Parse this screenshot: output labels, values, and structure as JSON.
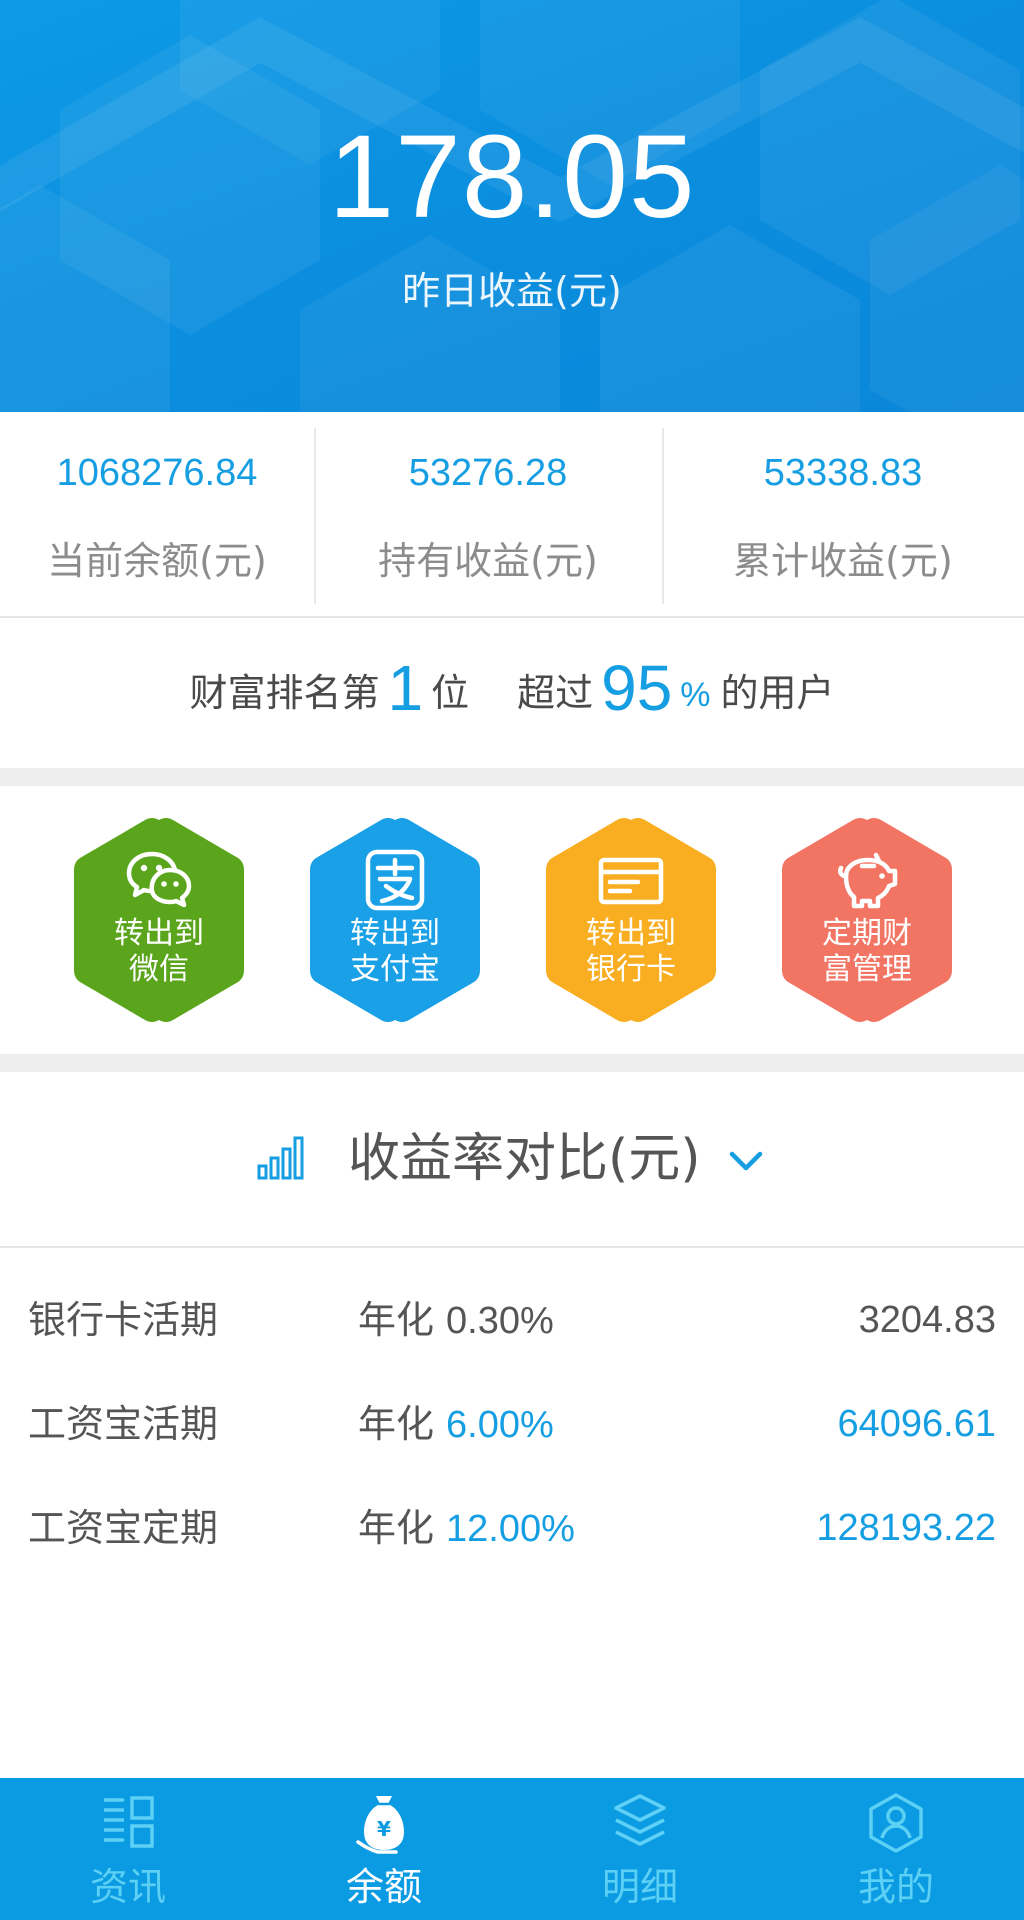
{
  "header": {
    "yesterday_income": "178.05",
    "yesterday_income_label": "昨日收益(元)"
  },
  "stats": [
    {
      "value": "1068276.84",
      "label": "当前余额(元)"
    },
    {
      "value": "53276.28",
      "label": "持有收益(元)"
    },
    {
      "value": "53338.83",
      "label": "累计收益(元)"
    }
  ],
  "ranking": {
    "prefix": "财富排名第",
    "rank": "1",
    "rank_suffix": "位",
    "beat_prefix": "超过",
    "percent": "95",
    "percent_sign": "%",
    "beat_suffix": "的用户"
  },
  "actions": [
    {
      "line1": "转出到",
      "line2": "微信",
      "icon": "wechat-icon",
      "color": "#5aa51c"
    },
    {
      "line1": "转出到",
      "line2": "支付宝",
      "icon": "alipay-icon",
      "color": "#1aa0e6"
    },
    {
      "line1": "转出到",
      "line2": "银行卡",
      "icon": "bank-card-icon",
      "color": "#f9ad20"
    },
    {
      "line1": "定期财",
      "line2": "富管理",
      "icon": "piggy-bank-icon",
      "color": "#f27564"
    }
  ],
  "comparison": {
    "title": "收益率对比(元)",
    "icon": "bar-chart-icon",
    "toggle_icon": "chevron-down-icon",
    "rows": [
      {
        "name": "银行卡活期",
        "rate_label": "年化",
        "rate": "0.30%",
        "amount": "3204.83",
        "highlight": false
      },
      {
        "name": "工资宝活期",
        "rate_label": "年化",
        "rate": "6.00%",
        "amount": "64096.61",
        "highlight": true
      },
      {
        "name": "工资宝定期",
        "rate_label": "年化",
        "rate": "12.00%",
        "amount": "128193.22",
        "highlight": true
      }
    ]
  },
  "tabbar": {
    "items": [
      {
        "label": "资讯",
        "icon": "news-icon",
        "active": false
      },
      {
        "label": "余额",
        "icon": "money-bag-icon",
        "active": true
      },
      {
        "label": "明细",
        "icon": "layers-icon",
        "active": false
      },
      {
        "label": "我的",
        "icon": "profile-icon",
        "active": false
      }
    ]
  },
  "colors": {
    "accent": "#169ee3",
    "tab_inactive": "#5cd0f5",
    "tab_active": "#ffffff",
    "text_dark": "#555555",
    "text_gray": "#8c8c8c"
  }
}
